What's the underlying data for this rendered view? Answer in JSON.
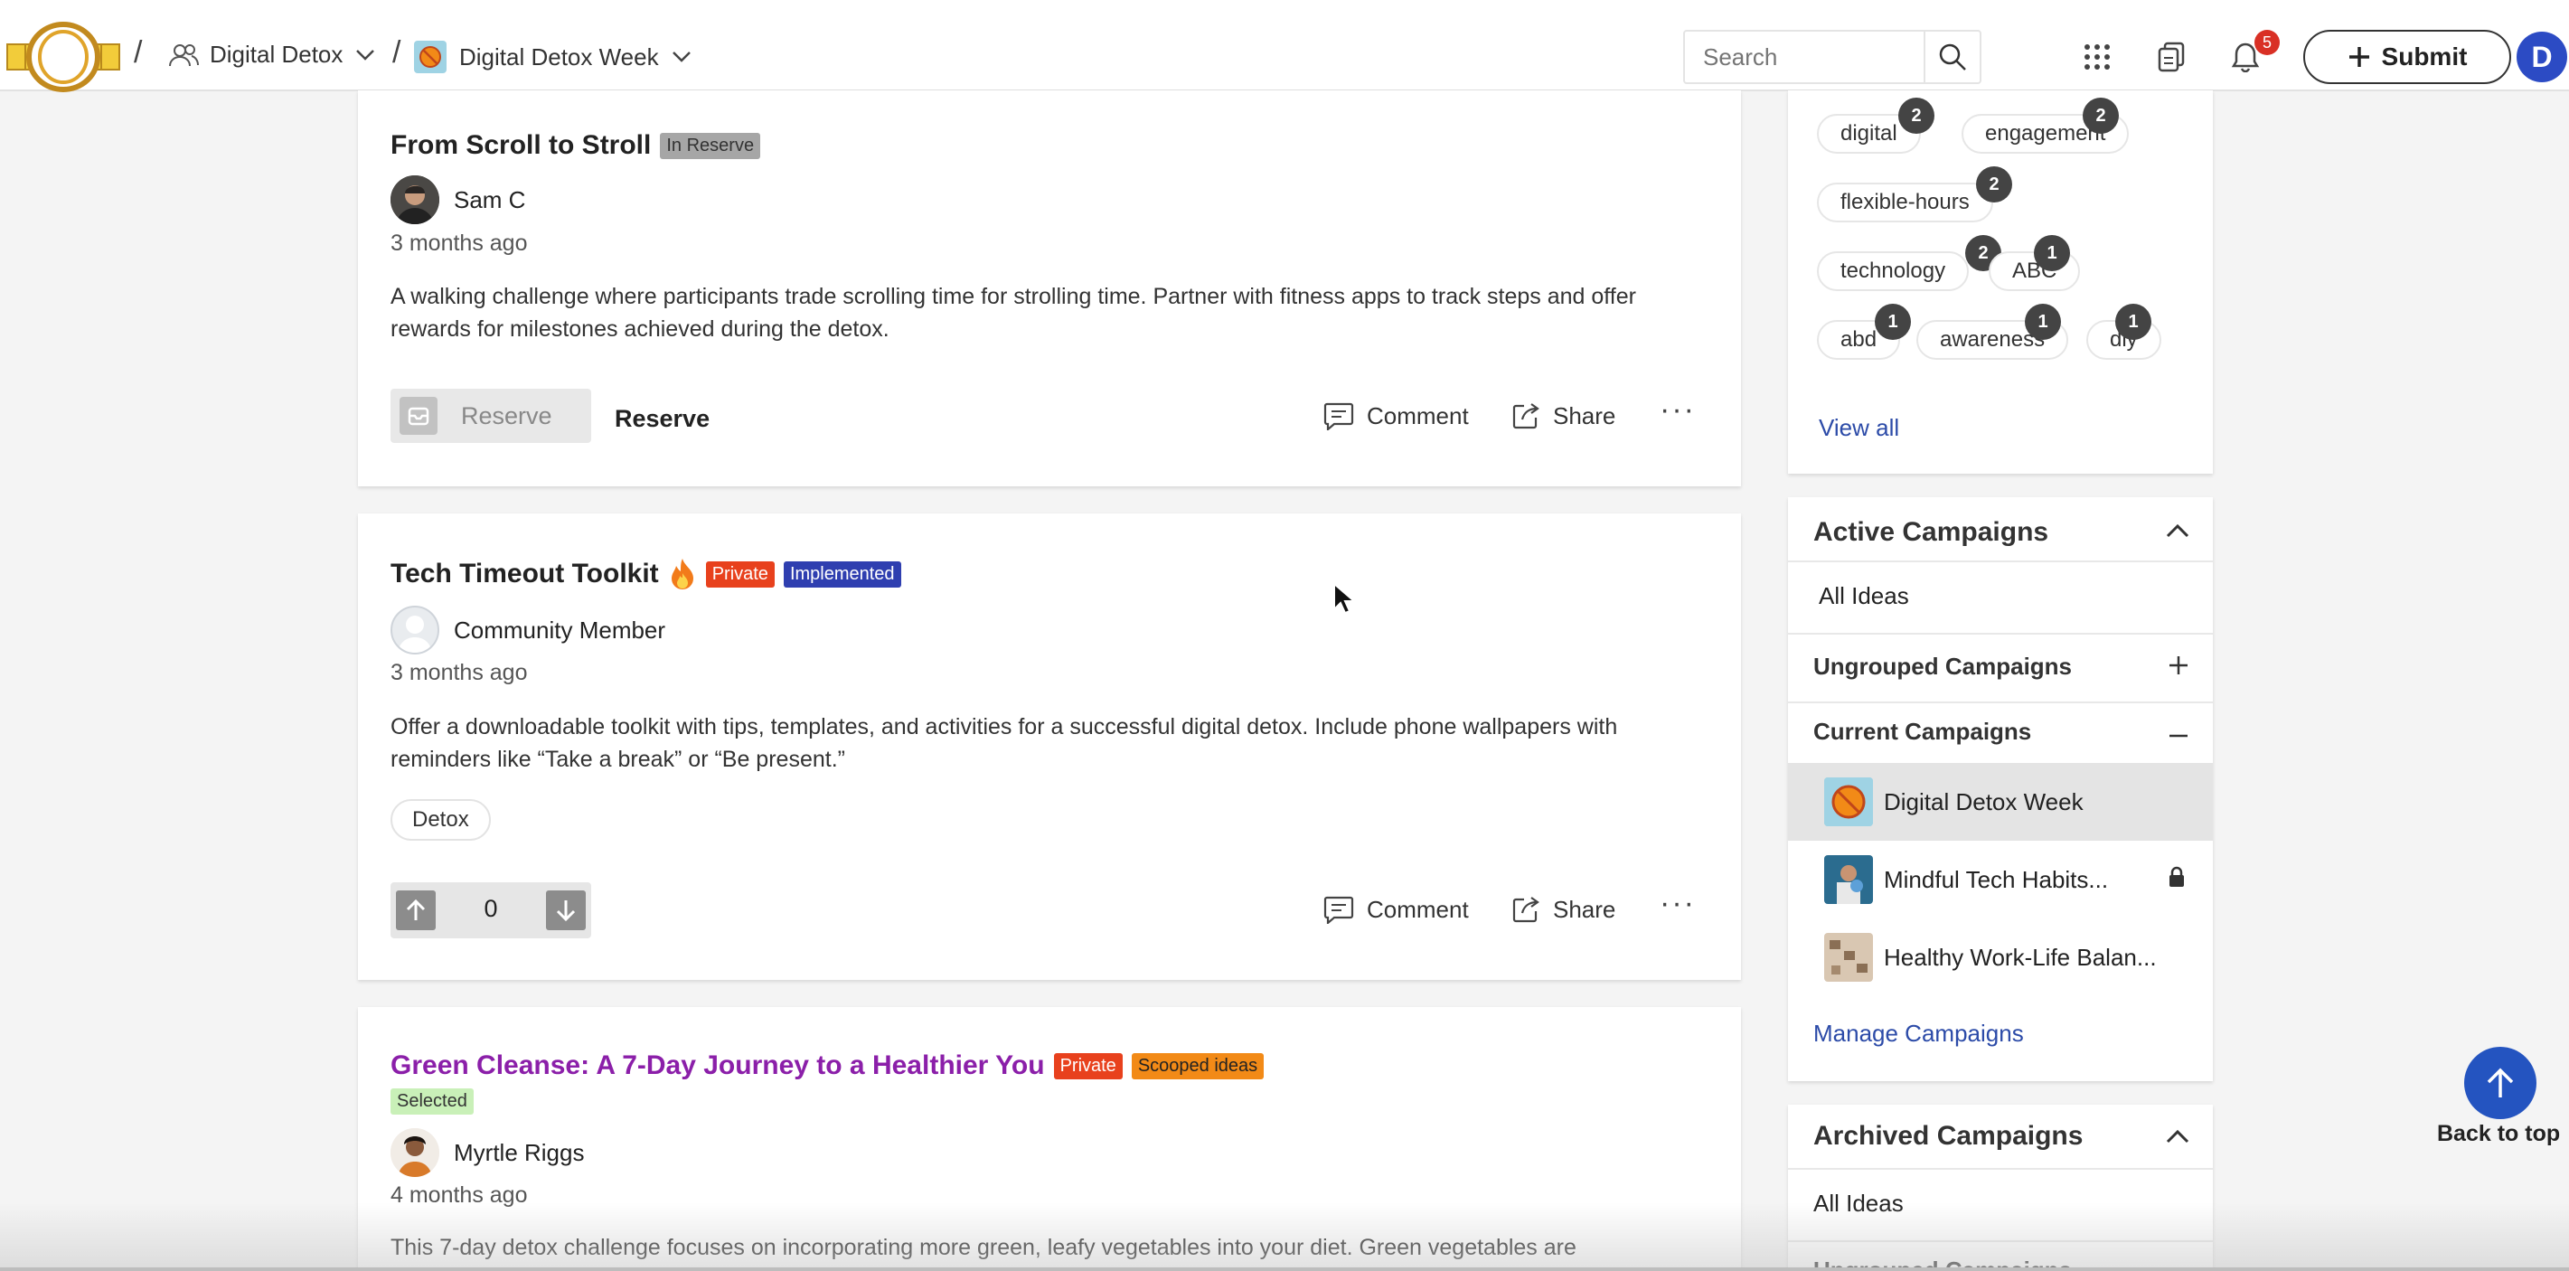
{
  "header": {
    "breadcrumb_sep": "/",
    "community": "Digital Detox",
    "campaign": "Digital Detox Week",
    "search_placeholder": "Search",
    "notification_count": "5",
    "submit_label": "Submit",
    "user_initial": "D"
  },
  "ideas": [
    {
      "title": "From Scroll to Stroll",
      "tags": [
        "In Reserve"
      ],
      "author": "Sam C",
      "time": "3 months ago",
      "description": "A walking challenge where participants trade scrolling time for strolling time. Partner with fitness apps to track steps and offer rewards for milestones achieved during the detox.",
      "reserve_button": "Reserve",
      "reserve_label": "Reserve",
      "comment": "Comment",
      "share": "Share",
      "more": "···"
    },
    {
      "title": "Tech Timeout Toolkit",
      "tags": [
        "Private",
        "Implemented"
      ],
      "author": "Community Member",
      "time": "3 months ago",
      "description": "Offer a downloadable toolkit with tips, templates, and activities for a successful digital detox. Include phone wallpapers with reminders like “Take a break” or “Be present.”",
      "chip": "Detox",
      "votes": "0",
      "comment": "Comment",
      "share": "Share",
      "more": "···"
    },
    {
      "title": "Green Cleanse: A 7-Day Journey to a Healthier You",
      "tags": [
        "Private",
        "Scooped ideas",
        "Selected"
      ],
      "author": "Myrtle Riggs",
      "time": "4 months ago",
      "description": "This 7-day detox challenge focuses on incorporating more green, leafy vegetables into your diet. Green vegetables are"
    }
  ],
  "tags_cloud": {
    "items": [
      {
        "label": "digital",
        "count": "2"
      },
      {
        "label": "engagement",
        "count": "2"
      },
      {
        "label": "flexible-hours",
        "count": "2"
      },
      {
        "label": "technology",
        "count": "2"
      },
      {
        "label": "ABC",
        "count": "1"
      },
      {
        "label": "abd",
        "count": "1"
      },
      {
        "label": "awareness",
        "count": "1"
      },
      {
        "label": "diy",
        "count": "1"
      }
    ],
    "view_all": "View all"
  },
  "active_campaigns": {
    "title": "Active Campaigns",
    "all_ideas": "All Ideas",
    "ungrouped": "Ungrouped Campaigns",
    "current": "Current Campaigns",
    "campaigns": [
      "Digital Detox Week",
      "Mindful Tech Habits...",
      "Healthy Work-Life Balan..."
    ],
    "manage": "Manage Campaigns"
  },
  "archived_campaigns": {
    "title": "Archived Campaigns",
    "all_ideas": "All Ideas",
    "ungrouped": "Ungrouped Campaigns"
  },
  "back_to_top": "Back to top",
  "colors": {
    "accent_blue": "#2454c0",
    "private": "#e8411d",
    "implemented": "#2f3fb0",
    "scooped": "#f28a17",
    "selected": "#c9f0b8",
    "title_purple": "#8b1fa9"
  }
}
